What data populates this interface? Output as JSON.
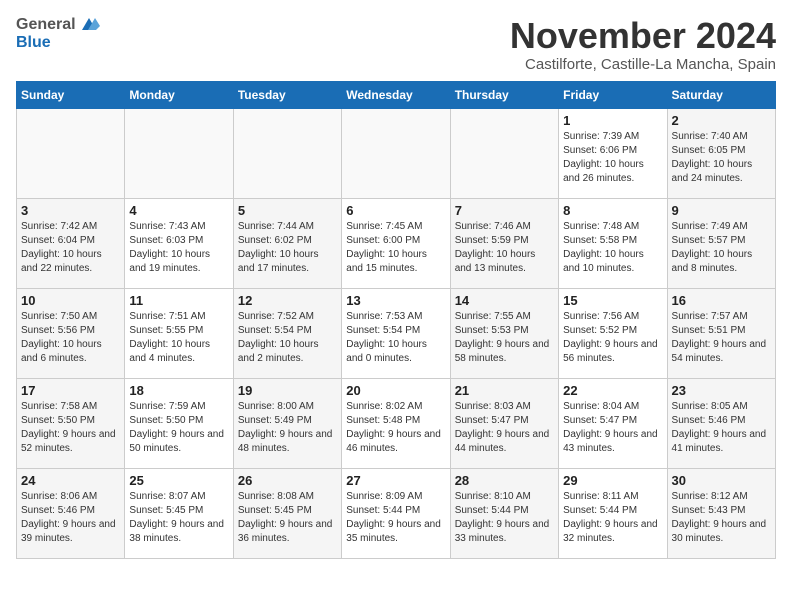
{
  "header": {
    "logo_general": "General",
    "logo_blue": "Blue",
    "month_title": "November 2024",
    "location": "Castilforte, Castille-La Mancha, Spain"
  },
  "days_of_week": [
    "Sunday",
    "Monday",
    "Tuesday",
    "Wednesday",
    "Thursday",
    "Friday",
    "Saturday"
  ],
  "weeks": [
    [
      {
        "day": "",
        "info": ""
      },
      {
        "day": "",
        "info": ""
      },
      {
        "day": "",
        "info": ""
      },
      {
        "day": "",
        "info": ""
      },
      {
        "day": "",
        "info": ""
      },
      {
        "day": "1",
        "info": "Sunrise: 7:39 AM\nSunset: 6:06 PM\nDaylight: 10 hours and 26 minutes."
      },
      {
        "day": "2",
        "info": "Sunrise: 7:40 AM\nSunset: 6:05 PM\nDaylight: 10 hours and 24 minutes."
      }
    ],
    [
      {
        "day": "3",
        "info": "Sunrise: 7:42 AM\nSunset: 6:04 PM\nDaylight: 10 hours and 22 minutes."
      },
      {
        "day": "4",
        "info": "Sunrise: 7:43 AM\nSunset: 6:03 PM\nDaylight: 10 hours and 19 minutes."
      },
      {
        "day": "5",
        "info": "Sunrise: 7:44 AM\nSunset: 6:02 PM\nDaylight: 10 hours and 17 minutes."
      },
      {
        "day": "6",
        "info": "Sunrise: 7:45 AM\nSunset: 6:00 PM\nDaylight: 10 hours and 15 minutes."
      },
      {
        "day": "7",
        "info": "Sunrise: 7:46 AM\nSunset: 5:59 PM\nDaylight: 10 hours and 13 minutes."
      },
      {
        "day": "8",
        "info": "Sunrise: 7:48 AM\nSunset: 5:58 PM\nDaylight: 10 hours and 10 minutes."
      },
      {
        "day": "9",
        "info": "Sunrise: 7:49 AM\nSunset: 5:57 PM\nDaylight: 10 hours and 8 minutes."
      }
    ],
    [
      {
        "day": "10",
        "info": "Sunrise: 7:50 AM\nSunset: 5:56 PM\nDaylight: 10 hours and 6 minutes."
      },
      {
        "day": "11",
        "info": "Sunrise: 7:51 AM\nSunset: 5:55 PM\nDaylight: 10 hours and 4 minutes."
      },
      {
        "day": "12",
        "info": "Sunrise: 7:52 AM\nSunset: 5:54 PM\nDaylight: 10 hours and 2 minutes."
      },
      {
        "day": "13",
        "info": "Sunrise: 7:53 AM\nSunset: 5:54 PM\nDaylight: 10 hours and 0 minutes."
      },
      {
        "day": "14",
        "info": "Sunrise: 7:55 AM\nSunset: 5:53 PM\nDaylight: 9 hours and 58 minutes."
      },
      {
        "day": "15",
        "info": "Sunrise: 7:56 AM\nSunset: 5:52 PM\nDaylight: 9 hours and 56 minutes."
      },
      {
        "day": "16",
        "info": "Sunrise: 7:57 AM\nSunset: 5:51 PM\nDaylight: 9 hours and 54 minutes."
      }
    ],
    [
      {
        "day": "17",
        "info": "Sunrise: 7:58 AM\nSunset: 5:50 PM\nDaylight: 9 hours and 52 minutes."
      },
      {
        "day": "18",
        "info": "Sunrise: 7:59 AM\nSunset: 5:50 PM\nDaylight: 9 hours and 50 minutes."
      },
      {
        "day": "19",
        "info": "Sunrise: 8:00 AM\nSunset: 5:49 PM\nDaylight: 9 hours and 48 minutes."
      },
      {
        "day": "20",
        "info": "Sunrise: 8:02 AM\nSunset: 5:48 PM\nDaylight: 9 hours and 46 minutes."
      },
      {
        "day": "21",
        "info": "Sunrise: 8:03 AM\nSunset: 5:47 PM\nDaylight: 9 hours and 44 minutes."
      },
      {
        "day": "22",
        "info": "Sunrise: 8:04 AM\nSunset: 5:47 PM\nDaylight: 9 hours and 43 minutes."
      },
      {
        "day": "23",
        "info": "Sunrise: 8:05 AM\nSunset: 5:46 PM\nDaylight: 9 hours and 41 minutes."
      }
    ],
    [
      {
        "day": "24",
        "info": "Sunrise: 8:06 AM\nSunset: 5:46 PM\nDaylight: 9 hours and 39 minutes."
      },
      {
        "day": "25",
        "info": "Sunrise: 8:07 AM\nSunset: 5:45 PM\nDaylight: 9 hours and 38 minutes."
      },
      {
        "day": "26",
        "info": "Sunrise: 8:08 AM\nSunset: 5:45 PM\nDaylight: 9 hours and 36 minutes."
      },
      {
        "day": "27",
        "info": "Sunrise: 8:09 AM\nSunset: 5:44 PM\nDaylight: 9 hours and 35 minutes."
      },
      {
        "day": "28",
        "info": "Sunrise: 8:10 AM\nSunset: 5:44 PM\nDaylight: 9 hours and 33 minutes."
      },
      {
        "day": "29",
        "info": "Sunrise: 8:11 AM\nSunset: 5:44 PM\nDaylight: 9 hours and 32 minutes."
      },
      {
        "day": "30",
        "info": "Sunrise: 8:12 AM\nSunset: 5:43 PM\nDaylight: 9 hours and 30 minutes."
      }
    ]
  ]
}
